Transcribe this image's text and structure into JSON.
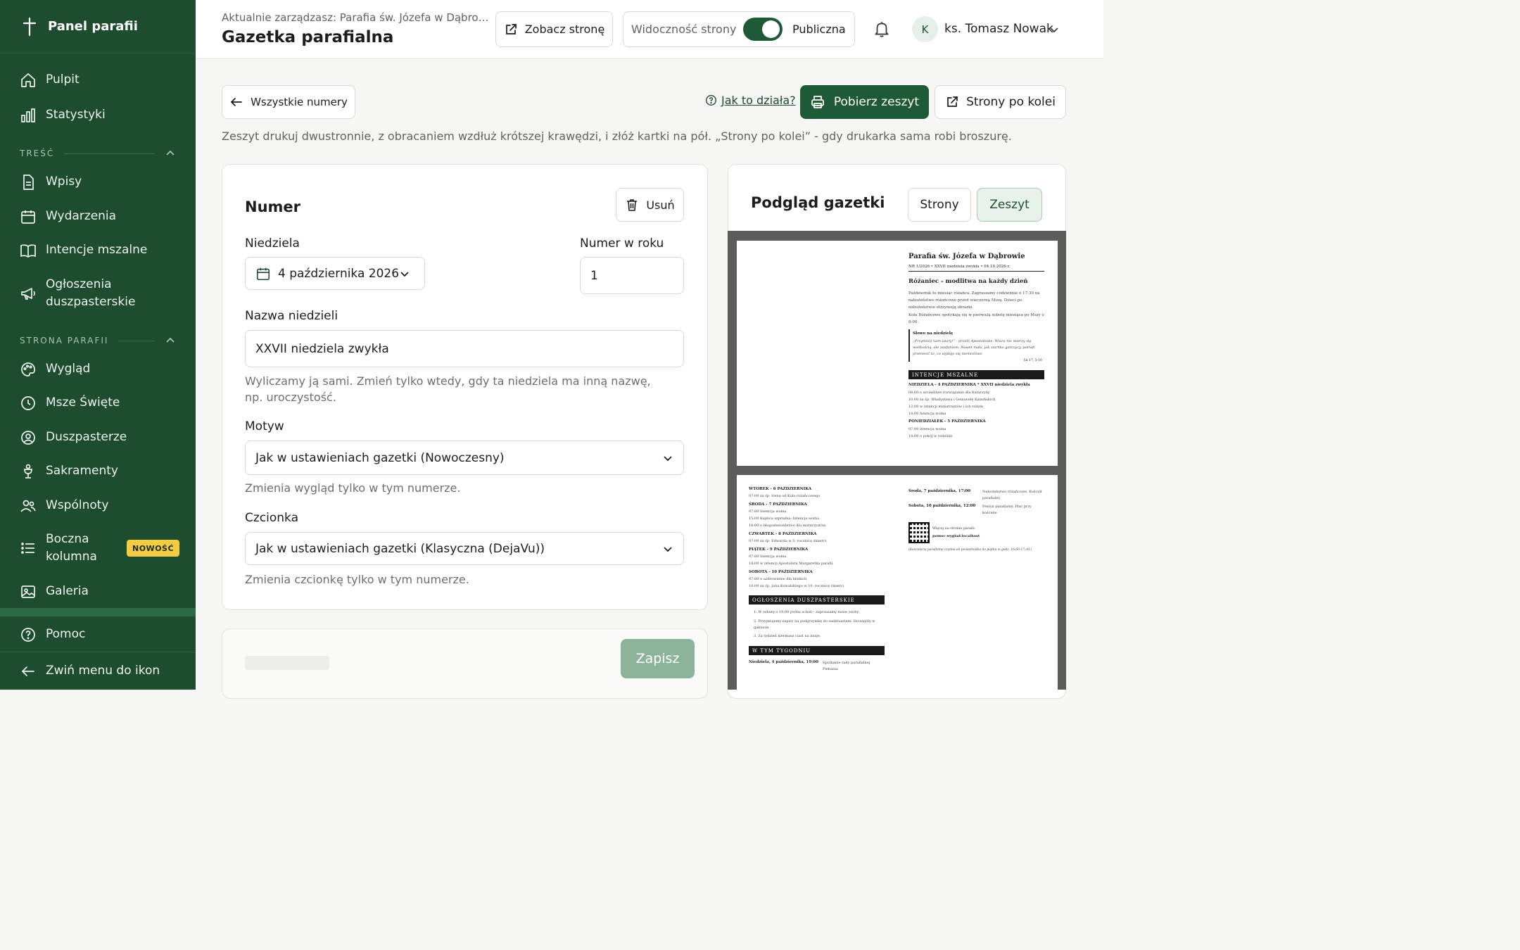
{
  "sidebar": {
    "title": "Panel parafii",
    "items_top": [
      {
        "label": "Pulpit",
        "icon": "home-icon"
      },
      {
        "label": "Statystyki",
        "icon": "bar-chart-icon"
      }
    ],
    "section_content": "TREŚĆ",
    "items_content": [
      {
        "label": "Wpisy",
        "icon": "document-icon"
      },
      {
        "label": "Wydarzenia",
        "icon": "calendar-icon"
      },
      {
        "label": "Intencje mszalne",
        "icon": "book-icon"
      },
      {
        "label": "Ogłoszenia duszpasterskie",
        "icon": "megaphone-icon"
      }
    ],
    "section_site": "STRONA PARAFII",
    "items_site": [
      {
        "label": "Wygląd",
        "icon": "palette-icon"
      },
      {
        "label": "Msze Święte",
        "icon": "clock-icon"
      },
      {
        "label": "Duszpasterze",
        "icon": "user-circle-icon"
      },
      {
        "label": "Sakramenty",
        "icon": "chalice-icon"
      },
      {
        "label": "Wspólnoty",
        "icon": "users-icon"
      },
      {
        "label": "Boczna kolumna",
        "icon": "list-icon"
      },
      {
        "label": "Galeria",
        "icon": "image-icon"
      }
    ],
    "badge_new": "NOWOŚĆ",
    "help": "Pomoc",
    "collapse": "Zwiń menu do ikon",
    "bg_color": "#1d4d2e"
  },
  "header": {
    "managing": "Aktualnie zarządzasz: Parafia św. Józefa w Dąbrowie",
    "title": "Gazetka parafialna",
    "view_site": "Zobacz stronę",
    "visibility_label": "Widoczność strony",
    "visibility_state": "Publiczna",
    "visibility_on": true,
    "user_initial": "K",
    "user_name": "ks. Tomasz Nowak"
  },
  "toolbar": {
    "back": "Wszystkie numery",
    "help": "Jak to działa?",
    "download": "Pobierz zeszyt",
    "pages_in_order": "Strony po kolei",
    "hint": "Zeszyt drukuj dwustronnie, z obracaniem wzdłuż krótszej krawędzi, i złóż kartki na pół. „Strony po kolei” - gdy drukarka sama robi broszurę."
  },
  "form": {
    "title": "Numer",
    "delete": "Usuń",
    "sunday_label": "Niedziela",
    "sunday_value": "4 października 2026",
    "number_label": "Numer w roku",
    "number_value": "1",
    "name_label": "Nazwa niedzieli",
    "name_value": "XXVII niedziela zwykła",
    "name_hint": "Wyliczamy ją sami. Zmień tylko wtedy, gdy ta niedziela ma inną nazwę, np. uroczystość.",
    "theme_label": "Motyw",
    "theme_value": "Jak w ustawieniach gazetki (Nowoczesny)",
    "theme_hint": "Zmienia wygląd tylko w tym numerze.",
    "font_label": "Czcionka",
    "font_value": "Jak w ustawieniach gazetki (Klasyczna (DejaVu))",
    "font_hint": "Zmienia czcionkę tylko w tym numerze.",
    "save": "Zapisz"
  },
  "preview": {
    "title": "Podgląd gazetki",
    "tab_pages": "Strony",
    "tab_booklet": "Zeszyt",
    "active_tab": "Zeszyt",
    "page1": {
      "parish": "Parafia św. Józefa w Dąbrowie",
      "issue": "NR 1/2026  •  XXVII niedziela zwykła  •  04.10.2026 r.",
      "headline": "Różaniec - modlitwa na każdy dzień",
      "para1": "Październik to miesiąc różańca. Zapraszamy codziennie o 17:30 na nabożeństwo różańcowe przed wieczorną Mszą. Dzieci po nabożeństwie otrzymują obrazki.",
      "para2": "Koła Różańcowe spotykają się w pierwszą sobotę miesiąca po Mszy o 8:00.",
      "quote_title": "Słowo na niedzielę",
      "quote": "„Przymnóż nam wiary!” - prosili Apostołowie. Wiara nie mierzy się wielkością, ale zaufaniem. Nawet mała, jak ziarnko gorczycy, potrafi przenieść to, co wydaje się niemożliwe.",
      "quote_ref": "Łk 17, 5-10",
      "intentions_bar": "INTENCJE MSZALNE",
      "day1": "NIEDZIELA - 4 PAŹDZIERNIKA * XXVII niedziela zwykła",
      "day1_lines": [
        "08:00 o szczęśliwe rozwiązanie dla Katarzyny",
        "10:00 za śp. Władysława i Genowefę Kamińskich",
        "12:00 w intencji ministrantów i ich rodzin",
        "18:00 Intencja wolna"
      ],
      "day2": "PONIEDZIAŁEK - 5 PAŹDZIERNIKA",
      "day2_lines": [
        "07:00 Intencja wolna",
        "18:00 o pokój w rodzinie"
      ]
    },
    "page2": {
      "left_days": [
        {
          "day": "WTOREK - 6 PAŹDZIERNIKA",
          "lines": [
            "07:00 za śp. Irenę od Koła różańcowego"
          ]
        },
        {
          "day": "ŚRODA - 7 PAŹDZIERNIKA",
          "lines": [
            "07:00 Intencja wolna",
            "15:00 Kaplica szpitalna: Intencja wolna",
            "18:00 o błogosławieństwo dla maturzystów"
          ]
        },
        {
          "day": "CZWARTEK - 8 PAŹDZIERNIKA",
          "lines": [
            "07:00 za śp. Edwarda w 5. rocznicę śmierci"
          ]
        },
        {
          "day": "PIĄTEK - 9 PAŹDZIERNIKA",
          "lines": [
            "07:00 Intencja wolna",
            "18:00 w intencji Apostolatu Margaretka parafii"
          ]
        },
        {
          "day": "SOBOTA - 10 PAŹDZIERNIKA",
          "lines": [
            "07:00 o uzdrowienie dla bliskich",
            "10:00 za śp. Jana Kowalskiego w 10. rocznicę śmierci"
          ]
        }
      ],
      "announcements_bar": "OGŁOSZENIA DUSZPASTERSKIE",
      "announcements": [
        "1. W sobotę o 10:00 próba scholi - zapraszamy nowe osoby.",
        "2. Przyjmujemy zapisy na pielgrzymkę do sanktuarium. Szczegóły w gablocie.",
        "3. Za tydzień kiermasz ciast na misje."
      ],
      "week_bar": "W TYM TYGODNIU",
      "week_left": "Niedziela, 4 października, 19:00",
      "week_left_desc": "Spotkanie rady parafialnej. Plebania",
      "right_events": [
        {
          "when": "Środa, 7 października, 17:00",
          "what": "Nabożeństwo różańcowe. Kościół parafialny"
        },
        {
          "when": "Sobota, 10 października, 12:00",
          "what": "Festyn parafialny. Plac przy kościele"
        }
      ],
      "qr_text": "Więcej na stronie parafii:",
      "qr_url": "pomoc-wyglad.localhost",
      "office_hours": "(Kancelaria parafialna czynna od poniedziałku do piątku w godz. 16:00-17:30.)"
    }
  },
  "colors": {
    "primary": "#1f5a36",
    "sidebar": "#1d4d2e",
    "badge": "#f3cc3f",
    "save_disabled": "#8bb49a"
  }
}
